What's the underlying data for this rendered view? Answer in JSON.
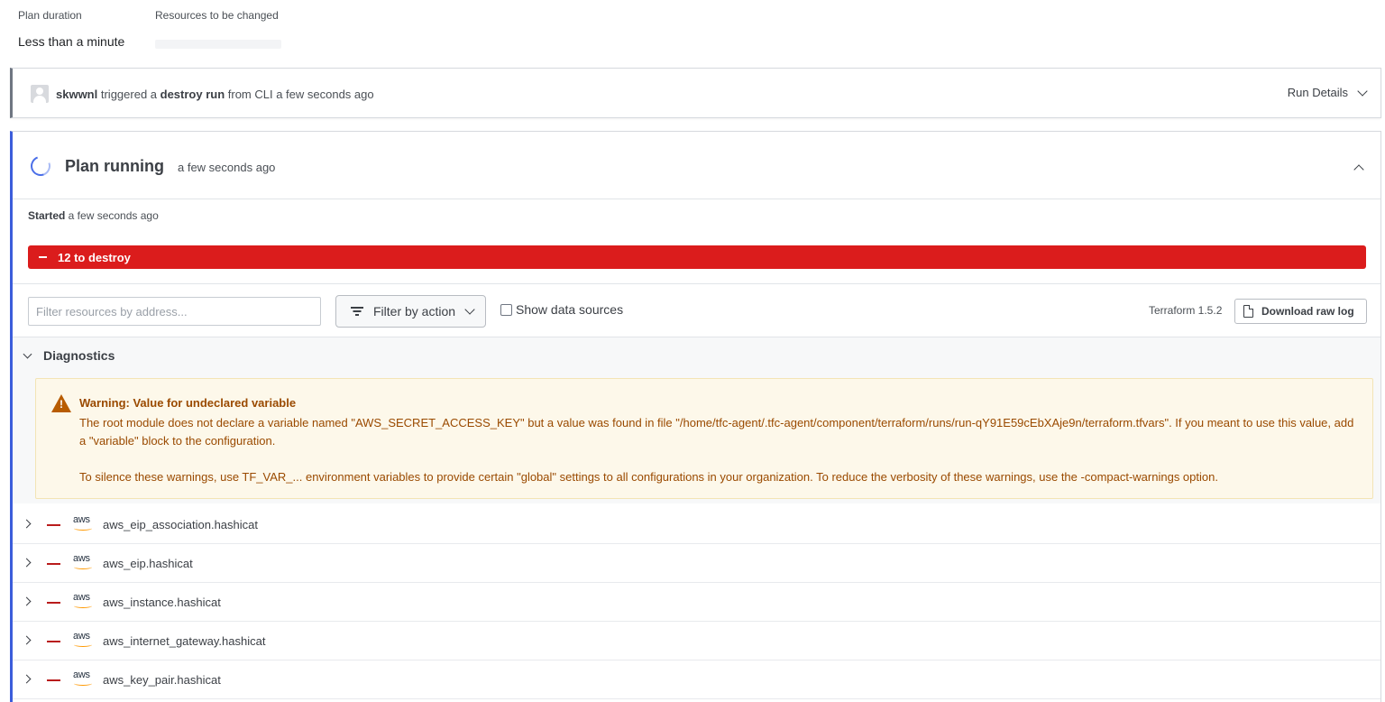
{
  "summary": {
    "plan_duration_label": "Plan duration",
    "plan_duration_value": "Less than a minute",
    "resources_changed_label": "Resources to be changed"
  },
  "run": {
    "user": "skwwnl",
    "text_triggered": " triggered a ",
    "run_type": "destroy run",
    "text_from": " from CLI a few seconds ago",
    "details_label": "Run Details"
  },
  "plan": {
    "title": "Plan running",
    "time": "a few seconds ago",
    "started_label": "Started",
    "started_time": " a few seconds ago",
    "destroy_summary": "12 to destroy",
    "destroy_color": "#db1c1c"
  },
  "toolbar": {
    "filter_placeholder": "Filter resources by address...",
    "filter_action_label": "Filter by action",
    "show_data_sources_label": "Show data sources",
    "terraform_version": "Terraform 1.5.2",
    "download_label": "Download raw log"
  },
  "diagnostics": {
    "heading": "Diagnostics",
    "warning_title": "Warning: Value for undeclared variable",
    "warning_body_1": "The root module does not declare a variable named \"AWS_SECRET_ACCESS_KEY\" but a value was found in file \"/home/tfc-agent/.tfc-agent/component/terraform/runs/run-qY91E59cEbXAje9n/terraform.tfvars\". If you meant to use this value, add a \"variable\" block to the configuration.",
    "warning_body_2": "To silence these warnings, use TF_VAR_... environment variables to provide certain \"global\" settings to all configurations in your organization. To reduce the verbosity of these warnings, use the -compact-warnings option."
  },
  "resources": [
    {
      "provider": "aws",
      "address": "aws_eip_association.hashicat"
    },
    {
      "provider": "aws",
      "address": "aws_eip.hashicat"
    },
    {
      "provider": "aws",
      "address": "aws_instance.hashicat"
    },
    {
      "provider": "aws",
      "address": "aws_internet_gateway.hashicat"
    },
    {
      "provider": "aws",
      "address": "aws_key_pair.hashicat"
    }
  ],
  "icons": {
    "avatar": "user-avatar-icon",
    "spinner": "spinner-icon",
    "warning": "warning-icon",
    "filter": "filter-icon",
    "document": "document-icon",
    "provider": "aws-logo-icon"
  }
}
